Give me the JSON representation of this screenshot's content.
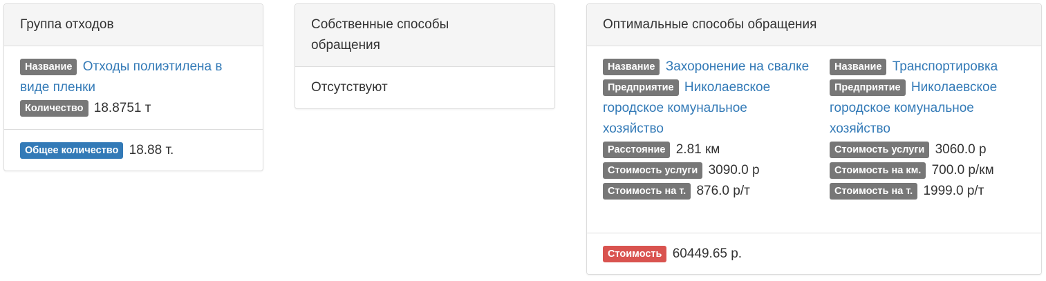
{
  "waste_group": {
    "heading": "Группа отходов",
    "name_label": "Название",
    "name_value": "Отходы полиэтилена в виде пленки",
    "quantity_label": "Количество",
    "quantity_value": "18.8751 т",
    "total_label": "Общее количество",
    "total_value": "18.88 т."
  },
  "own_methods": {
    "heading": "Собственные способы обращения",
    "body": "Отсутствуют"
  },
  "optimal_methods": {
    "heading": "Оптимальные способы обращения",
    "left": {
      "name_label": "Название",
      "name_value": "Захоронение на свалке",
      "enterprise_label": "Предприятие",
      "enterprise_value": "Николаевское городское комунальное хозяйство",
      "distance_label": "Расстояние",
      "distance_value": "2.81 км",
      "service_cost_label": "Стоимость услуги",
      "service_cost_value": "3090.0 р",
      "cost_per_ton_label": "Стоимость на т.",
      "cost_per_ton_value": "876.0 р/т"
    },
    "right": {
      "name_label": "Название",
      "name_value": "Транспортировка",
      "enterprise_label": "Предприятие",
      "enterprise_value": "Николаевское городское комунальное хозяйство",
      "service_cost_label": "Стоимость услуги",
      "service_cost_value": "3060.0 р",
      "cost_per_km_label": "Стоимость на км.",
      "cost_per_km_value": "700.0 р/км",
      "cost_per_ton_label": "Стоимость на т.",
      "cost_per_ton_value": "1999.0 р/т"
    },
    "total_label": "Стоимость",
    "total_value": "60449.65 р."
  },
  "colors": {
    "label_default": "#777777",
    "label_primary": "#337ab7",
    "label_danger": "#d9534f",
    "link": "#337ab7"
  }
}
